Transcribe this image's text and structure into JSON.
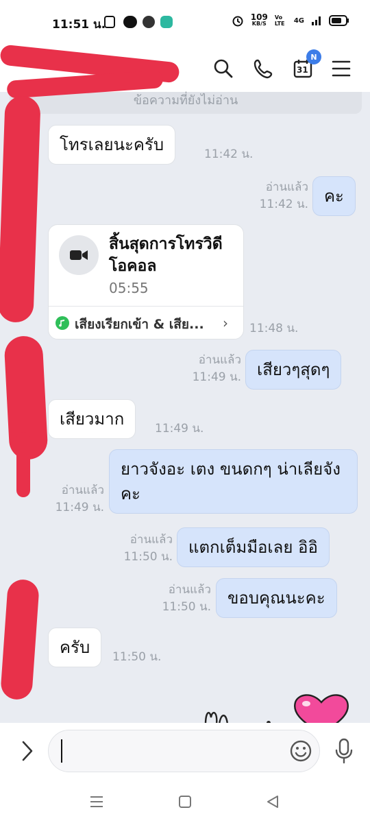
{
  "status_bar": {
    "time": "11:51 น.",
    "net_speed_value": "109",
    "net_speed_unit": "KB/S",
    "volte": "Vo LTE",
    "network": "4G"
  },
  "header": {
    "contact_name": "",
    "calendar_day": "31",
    "calendar_badge": "N"
  },
  "unread_divider": "ข้อความที่ยังไม่อ่าน",
  "messages": [
    {
      "text": "โทรเลยนะครับ",
      "time": "11:42 น."
    },
    {
      "text": "คะ",
      "read": "อ่านแล้ว",
      "time": "11:42 น."
    },
    {
      "time": "11:48 น."
    },
    {
      "text": "เสียวๆสุดๆ",
      "read": "อ่านแล้ว",
      "time": "11:49 น."
    },
    {
      "text": "เสียวมาก",
      "time": "11:49 น."
    },
    {
      "text": "ยาวจังอะ เตง ขนดกๆ น่าเลียจังคะ",
      "read": "อ่านแล้ว",
      "time": "11:49 น."
    },
    {
      "text": "แตกเต็มมือเลย อิอิ",
      "read": "อ่านแล้ว",
      "time": "11:50 น."
    },
    {
      "text": "ขอบคุณนะคะ",
      "read": "อ่านแล้ว",
      "time": "11:50 น."
    },
    {
      "text": "ครับ",
      "time": "11:50 น."
    }
  ],
  "call_card": {
    "title": "สิ้นสุดการโทรวิดีโอคอล",
    "duration": "05:55",
    "footer": "เสียงเรียกเข้า & เสีย..."
  },
  "input": {
    "value": "",
    "placeholder": ""
  },
  "colors": {
    "outgoing_bubble": "#d6e4fb",
    "incoming_bubble": "#ffffff",
    "background": "#e9ecf2",
    "badge": "#3d7de8",
    "redaction": "#e8314a"
  }
}
